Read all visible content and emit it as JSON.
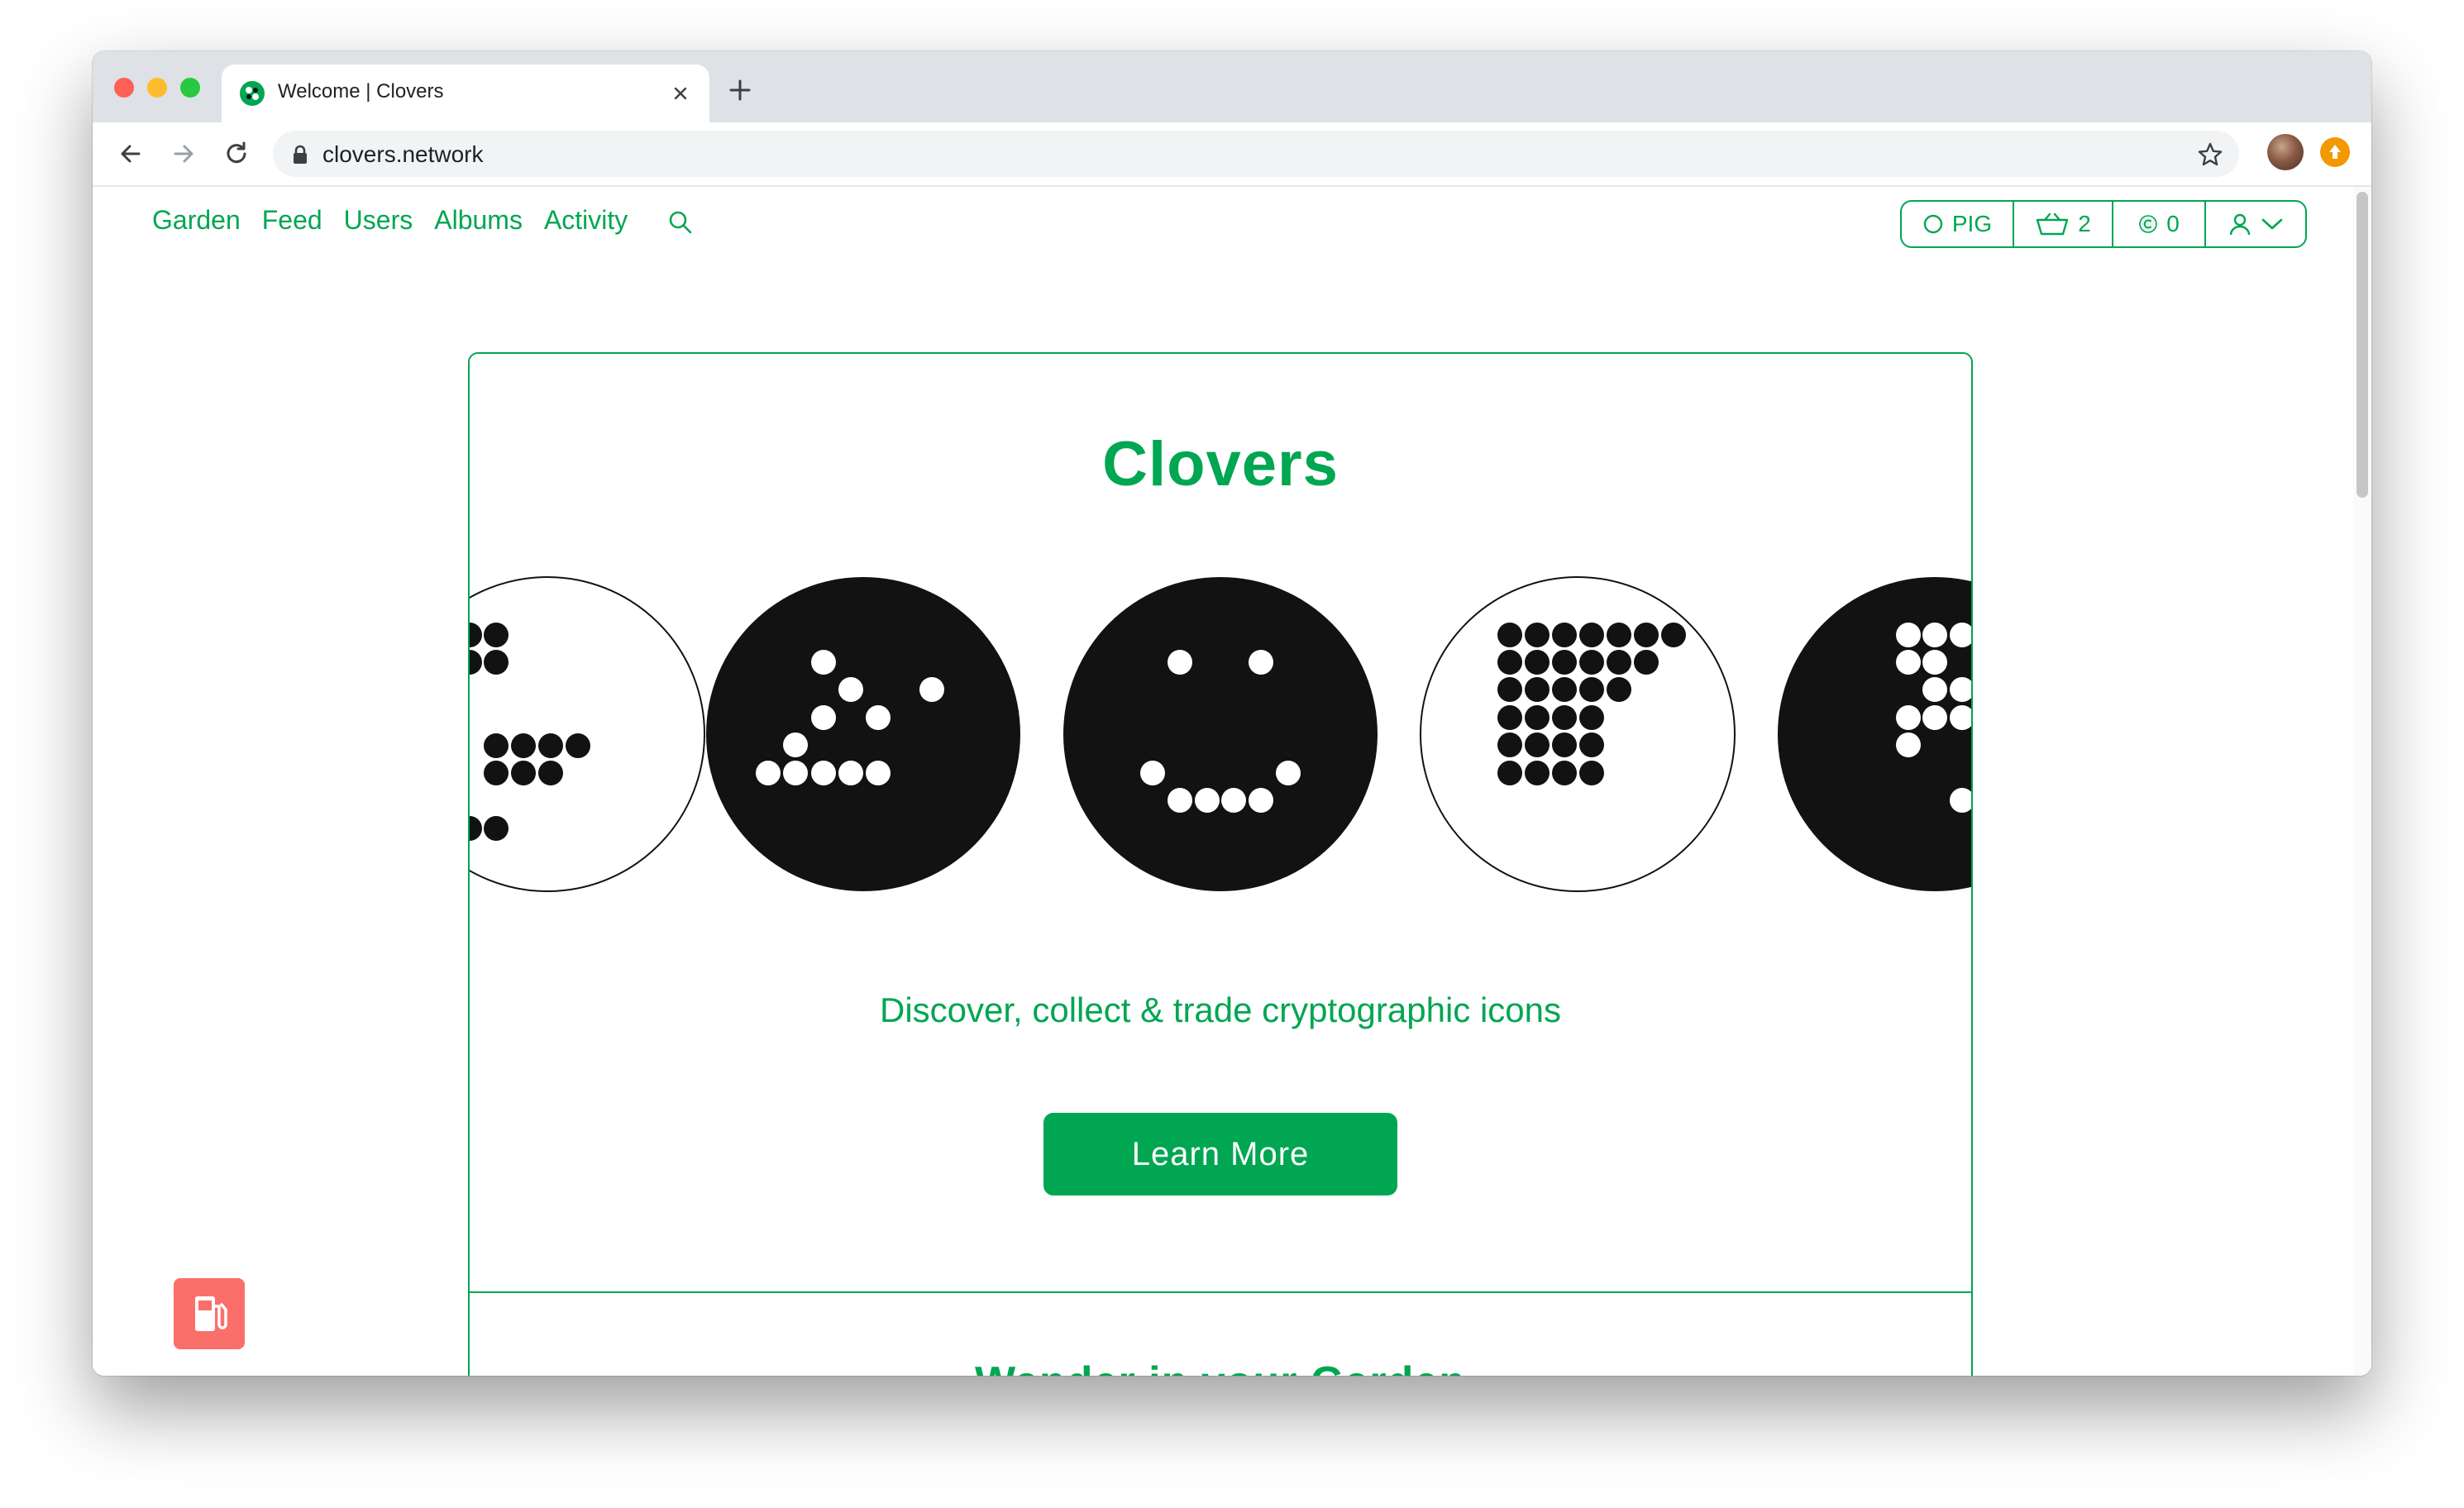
{
  "browser": {
    "tab_title": "Welcome | Clovers",
    "url": "clovers.network"
  },
  "nav": {
    "items": [
      "Garden",
      "Feed",
      "Users",
      "Albums",
      "Activity"
    ]
  },
  "userbar": {
    "network_label": "PIG",
    "basket_count": "2",
    "coin_count": "0"
  },
  "hero": {
    "title": "Clovers",
    "tagline": "Discover, collect & trade cryptographic icons",
    "cta_label": "Learn More"
  },
  "section": {
    "title": "Wander in your Garden"
  },
  "colors": {
    "brand_green": "#00a651",
    "gas_red": "#fb6f6a",
    "clover_black": "#121212"
  }
}
